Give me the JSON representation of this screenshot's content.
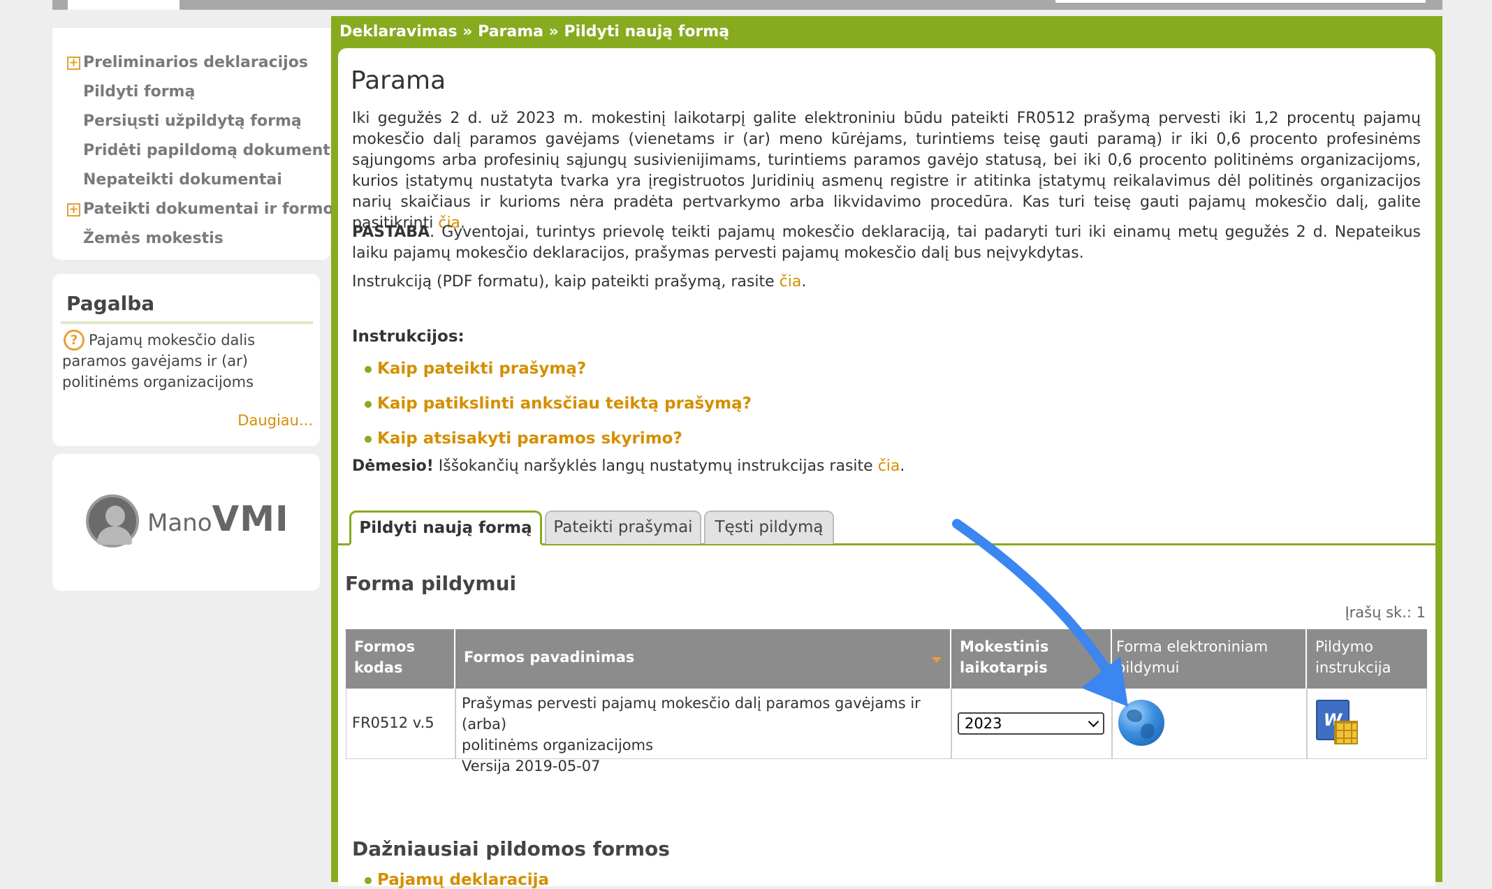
{
  "nav": {
    "items": [
      {
        "label": "Preliminarios deklaracijos",
        "expandable": true
      },
      {
        "label": "Pildyti formą",
        "expandable": false
      },
      {
        "label": "Persiųsti užpildytą formą",
        "expandable": false
      },
      {
        "label": "Pridėti papildomą dokumentą",
        "expandable": false
      },
      {
        "label": "Nepateikti dokumentai",
        "expandable": false
      },
      {
        "label": "Pateikti dokumentai ir formos",
        "expandable": true
      },
      {
        "label": "Žemės mokestis",
        "expandable": false
      }
    ],
    "plus_glyph": "+"
  },
  "help": {
    "title": "Pagalba",
    "icon_glyph": "?",
    "text": "Pajamų mokesčio dalis paramos gavėjams ir (ar) politinėms organizacijoms",
    "more": "Daugiau..."
  },
  "logo": {
    "mano": "Mano",
    "vmi": "VMI"
  },
  "breadcrumb": "Deklaravimas » Parama » Pildyti naują formą",
  "page_title": "Parama",
  "intro": {
    "text": "Iki gegužės 2 d. už 2023 m. mokestinį laikotarpį galite elektroniniu būdu pateikti FR0512 prašymą pervesti iki 1,2 procentų pajamų mokesčio dalį paramos gavėjams (vienetams ir (ar) meno kūrėjams, turintiems teisę gauti paramą) ir iki 0,6 procento profesinėms sąjungoms arba profesinių sąjungų susivienijimams, turintiems paramos gavėjo statusą, bei iki 0,6 procento politinėms organizacijoms, kurios įstatymų nustatyta tvarka yra įregistruotos Juridinių asmenų registre ir atitinka įstatymų reikalavimus dėl politinės organizacijos narių skaičiaus ir kurioms nėra pradėta pertvarkymo arba likvidavimo procedūra. Kas turi teisę gauti pajamų mokesčio dalį, galite pasitikrinti ",
    "link": "čia",
    "tail": "."
  },
  "note": {
    "bold": "PASTABA",
    "text": ". Gyventojai, turintys prievolę teikti pajamų mokesčio deklaraciją, tai padaryti turi iki einamų metų gegužės 2 d. Nepateikus laiku pajamų mokesčio deklaracijos, prašymas pervesti pajamų mokesčio dalį bus neįvykdytas."
  },
  "pdf_line": {
    "text": "Instrukciją (PDF formatu), kaip pateikti prašymą, rasite ",
    "link": "čia",
    "tail": "."
  },
  "instructions": {
    "heading": "Instrukcijos:",
    "items": [
      "Kaip pateikti prašymą?",
      "Kaip patikslinti anksčiau teiktą prašymą?",
      "Kaip atsisakyti paramos skyrimo?"
    ]
  },
  "attention": {
    "bold": "Dėmesio!",
    "text": " Iššokančių naršyklės langų nustatymų instrukcijas rasite ",
    "link": "čia",
    "tail": "."
  },
  "tabs": [
    "Pildyti naują formą",
    "Pateikti prašymai",
    "Tęsti pildymą"
  ],
  "section_title": "Forma pildymui",
  "record_count": "Įrašų sk.: 1",
  "table": {
    "headers": {
      "code": [
        "Formos",
        "kodas"
      ],
      "name": "Formos pavadinimas",
      "period": [
        "Mokestinis",
        "laikotarpis"
      ],
      "electronic": [
        "Forma elektroniniam",
        "pildymui"
      ],
      "instructions": [
        "Pildymo",
        "instrukcija"
      ]
    },
    "row": {
      "code": "FR0512 v.5",
      "name_line1": "Prašymas pervesti pajamų mokesčio dalį paramos gavėjams ir (arba)",
      "name_line2": "politinėms organizacijoms",
      "version": "Versija 2019-05-07",
      "period": "2023",
      "electronic_icon": "globe-icon",
      "instructions_icon": "word-document-icon",
      "word_glyph": "W"
    }
  },
  "frequent": {
    "title": "Dažniausiai pildomos formos",
    "items": [
      "Pajamų deklaracija"
    ]
  },
  "colors": {
    "green": "#86ab1f",
    "link": "#d48f00",
    "arrow": "#3b86f0",
    "header_gray": "#8c8c8c"
  }
}
